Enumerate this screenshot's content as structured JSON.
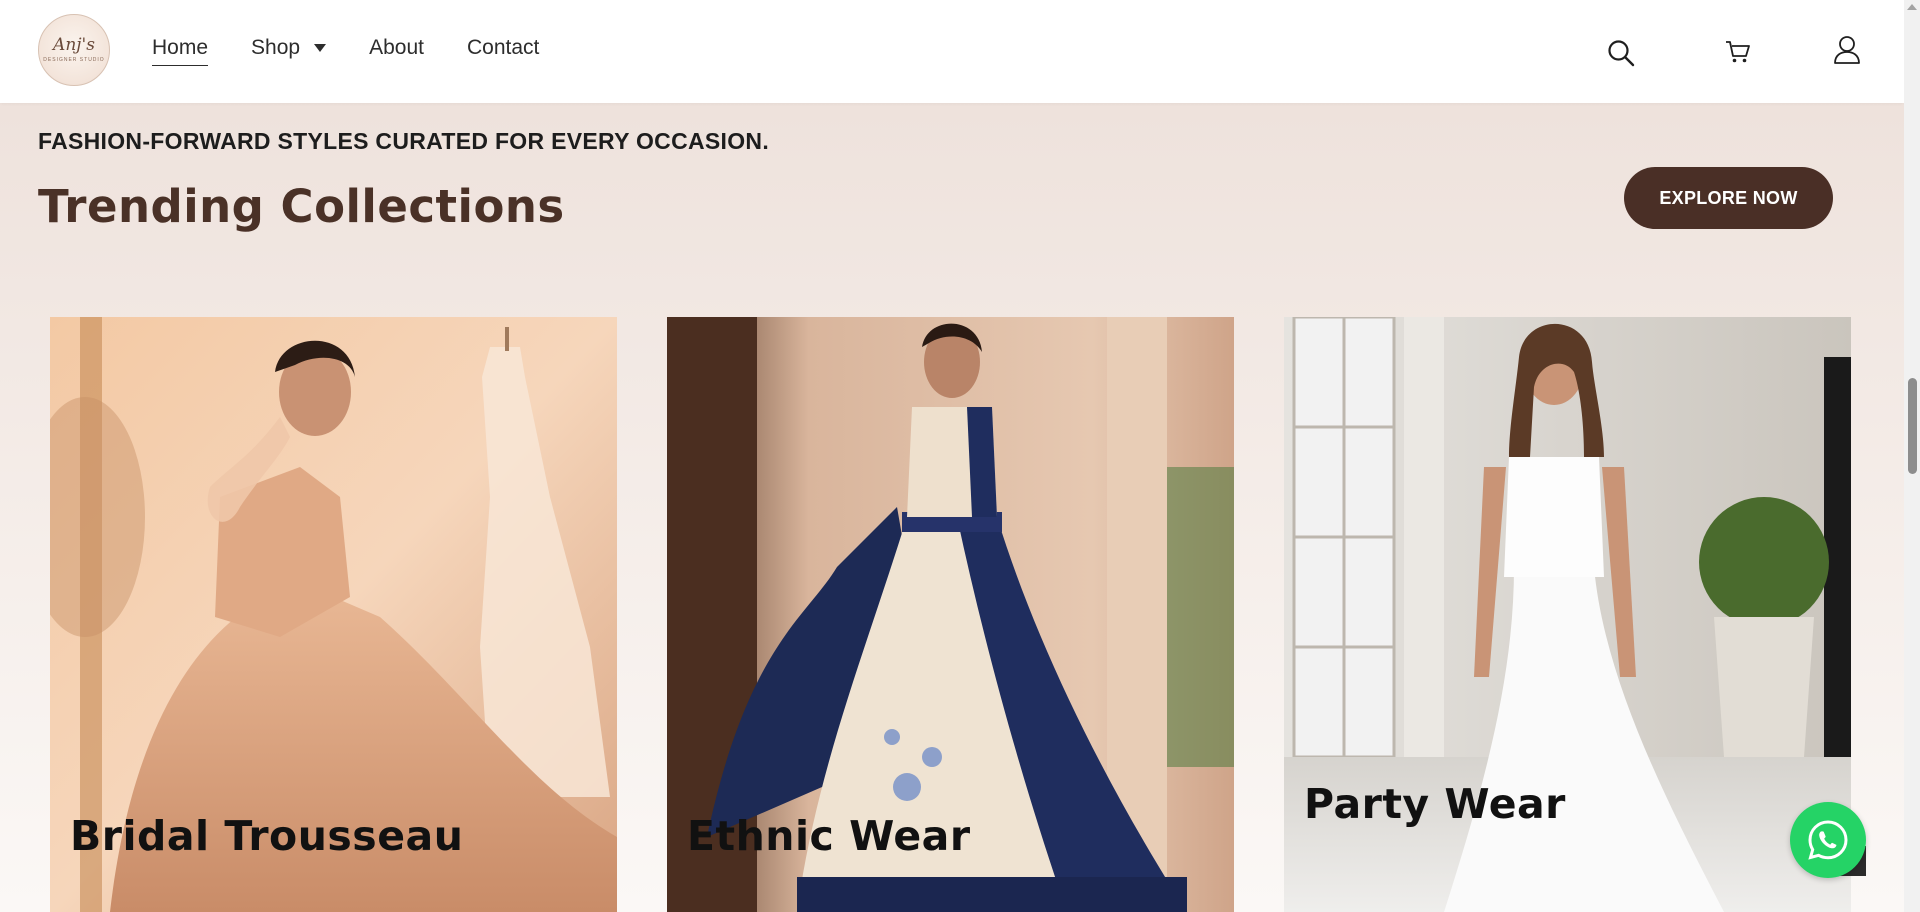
{
  "header": {
    "logo": {
      "mark": "Anj's",
      "sub": "DESIGNER STUDIO"
    },
    "nav": [
      {
        "label": "Home",
        "active": true
      },
      {
        "label": "Shop",
        "has_dropdown": true
      },
      {
        "label": "About"
      },
      {
        "label": "Contact"
      }
    ],
    "icons": [
      "search-icon",
      "cart-icon",
      "user-icon"
    ]
  },
  "hero": {
    "tagline": "FASHION-FORWARD STYLES CURATED FOR EVERY OCCASION.",
    "title": "Trending Collections",
    "cta_label": "EXPLORE NOW"
  },
  "collections": [
    {
      "label": "Bridal Trousseau"
    },
    {
      "label": "Ethnic Wear"
    },
    {
      "label": "Party Wear"
    }
  ],
  "floating": {
    "whatsapp_icon": "whatsapp-icon",
    "scroll_top_icon": "scroll-top-icon"
  },
  "colors": {
    "brand_brown": "#4a2f26",
    "title_brown": "#4a3127",
    "whatsapp_green": "#25d366"
  }
}
